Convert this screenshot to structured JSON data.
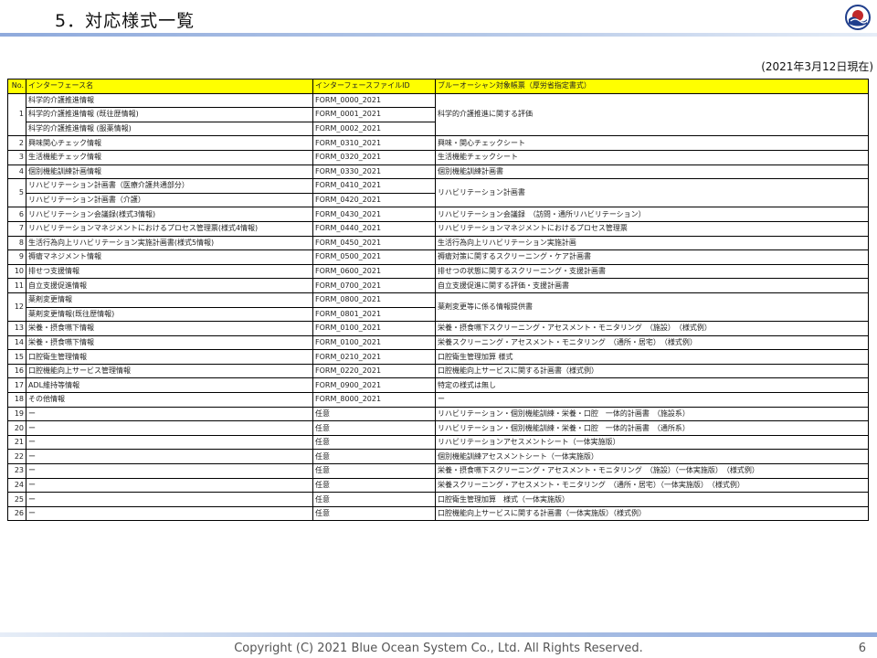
{
  "header": {
    "title": "5．対応様式一覧",
    "date_note": "(2021年3月12日現在)"
  },
  "table": {
    "columns": [
      "No.",
      "インターフェース名",
      "インターフェースファイルID",
      "ブルーオーシャン対象帳票（厚労省指定書式）"
    ],
    "rows": [
      {
        "no": "1",
        "sub": [
          {
            "name": "科学的介護推進情報",
            "id": "FORM_0000_2021"
          },
          {
            "name": "科学的介護推進情報 (既往歴情報)",
            "id": "FORM_0001_2021"
          },
          {
            "name": "科学的介護推進情報 (服薬情報)",
            "id": "FORM_0002_2021"
          }
        ],
        "eval": "科学的介護推進に関する評価"
      },
      {
        "no": "2",
        "sub": [
          {
            "name": "興味関心チェック情報",
            "id": "FORM_0310_2021"
          }
        ],
        "eval": "興味・関心チェックシート"
      },
      {
        "no": "3",
        "sub": [
          {
            "name": "生活機能チェック情報",
            "id": "FORM_0320_2021"
          }
        ],
        "eval": "生活機能チェックシート"
      },
      {
        "no": "4",
        "sub": [
          {
            "name": "個別機能訓練計画情報",
            "id": "FORM_0330_2021"
          }
        ],
        "eval": "個別機能訓練計画書"
      },
      {
        "no": "5",
        "sub": [
          {
            "name": "リハビリテーション計画書（医療介護共通部分）",
            "id": "FORM_0410_2021"
          },
          {
            "name": "リハビリテーション計画書（介護）",
            "id": "FORM_0420_2021"
          }
        ],
        "eval": "リハビリテーション計画書"
      },
      {
        "no": "6",
        "sub": [
          {
            "name": "リハビリテーション会議録(様式3情報)",
            "id": "FORM_0430_2021"
          }
        ],
        "eval": "リハビリテーション会議録　（訪問・通所リハビリテーション）"
      },
      {
        "no": "7",
        "sub": [
          {
            "name": "リハビリテーションマネジメントにおけるプロセス管理票(様式4情報)",
            "id": "FORM_0440_2021"
          }
        ],
        "eval": "リハビリテーションマネジメントにおけるプロセス管理票"
      },
      {
        "no": "8",
        "sub": [
          {
            "name": "生活行為向上リハビリテーション実施計画書(様式5情報)",
            "id": "FORM_0450_2021"
          }
        ],
        "eval": "生活行為向上リハビリテーション実施計画"
      },
      {
        "no": "9",
        "sub": [
          {
            "name": "褥瘡マネジメント情報",
            "id": "FORM_0500_2021"
          }
        ],
        "eval": "褥瘡対策に関するスクリーニング・ケア計画書"
      },
      {
        "no": "10",
        "sub": [
          {
            "name": "排せつ支援情報",
            "id": "FORM_0600_2021"
          }
        ],
        "eval": "排せつの状態に関するスクリーニング・支援計画書"
      },
      {
        "no": "11",
        "sub": [
          {
            "name": "自立支援促進情報",
            "id": "FORM_0700_2021"
          }
        ],
        "eval": "自立支援促進に関する評価・支援計画書"
      },
      {
        "no": "12",
        "sub": [
          {
            "name": "薬剤変更情報",
            "id": "FORM_0800_2021"
          },
          {
            "name": "薬剤変更情報(既往歴情報)",
            "id": "FORM_0801_2021"
          }
        ],
        "eval": "薬剤変更等に係る情報提供書"
      },
      {
        "no": "13",
        "sub": [
          {
            "name": "栄養・摂食嚥下情報",
            "id": "FORM_0100_2021"
          }
        ],
        "eval": "栄養・摂食嚥下スクリーニング・アセスメント・モニタリング　（施設）　（様式例）"
      },
      {
        "no": "14",
        "sub": [
          {
            "name": "栄養・摂食嚥下情報",
            "id": "FORM_0100_2021"
          }
        ],
        "eval": "栄養スクリーニング・アセスメント・モニタリング　（通所・居宅）　（様式例）"
      },
      {
        "no": "15",
        "sub": [
          {
            "name": "口腔衛生管理情報",
            "id": "FORM_0210_2021"
          }
        ],
        "eval": "口腔衛生管理加算 様式"
      },
      {
        "no": "16",
        "sub": [
          {
            "name": "口腔機能向上サービス管理情報",
            "id": "FORM_0220_2021"
          }
        ],
        "eval": "口腔機能向上サービスに関する計画書（様式例）"
      },
      {
        "no": "17",
        "sub": [
          {
            "name": "ADL維持等情報",
            "id": "FORM_0900_2021"
          }
        ],
        "eval": "特定の様式は無し"
      },
      {
        "no": "18",
        "sub": [
          {
            "name": "その他情報",
            "id": "FORM_8000_2021"
          }
        ],
        "eval": "ー"
      },
      {
        "no": "19",
        "sub": [
          {
            "name": "ー",
            "id": "任意"
          }
        ],
        "eval": "リハビリテーション・個別機能訓練・栄養・口腔　一体的計画書　（施設系）"
      },
      {
        "no": "20",
        "sub": [
          {
            "name": "ー",
            "id": "任意"
          }
        ],
        "eval": "リハビリテーション・個別機能訓練・栄養・口腔　一体的計画書　（通所系）"
      },
      {
        "no": "21",
        "sub": [
          {
            "name": "ー",
            "id": "任意"
          }
        ],
        "eval": "リハビリテーションアセスメントシート（一体実施版）"
      },
      {
        "no": "22",
        "sub": [
          {
            "name": "ー",
            "id": "任意"
          }
        ],
        "eval": "個別機能訓練アセスメントシート（一体実施版）"
      },
      {
        "no": "23",
        "sub": [
          {
            "name": "ー",
            "id": "任意"
          }
        ],
        "eval": "栄養・摂食嚥下スクリーニング・アセスメント・モニタリング　（施設）（一体実施版）　（様式例）"
      },
      {
        "no": "24",
        "sub": [
          {
            "name": "ー",
            "id": "任意"
          }
        ],
        "eval": "栄養スクリーニング・アセスメント・モニタリング　（通所・居宅）（一体実施版）　（様式例）"
      },
      {
        "no": "25",
        "sub": [
          {
            "name": "ー",
            "id": "任意"
          }
        ],
        "eval": "口腔衛生管理加算　様式（一体実施版）"
      },
      {
        "no": "26",
        "sub": [
          {
            "name": "ー",
            "id": "任意"
          }
        ],
        "eval": "口腔機能向上サービスに関する計画書（一体実施版）（様式例）"
      }
    ]
  },
  "footer": {
    "copyright": "Copyright (C) 2021 Blue Ocean System Co., Ltd. All Rights Reserved.",
    "page": "6"
  },
  "colors": {
    "header_fill": "#ffff00",
    "rule": "#8faadc",
    "logo_blue": "#1f3e8c",
    "logo_red": "#c0282a"
  },
  "logo": {
    "icon": "blue-ocean-logo-icon",
    "text": "Blue Ocean System"
  }
}
